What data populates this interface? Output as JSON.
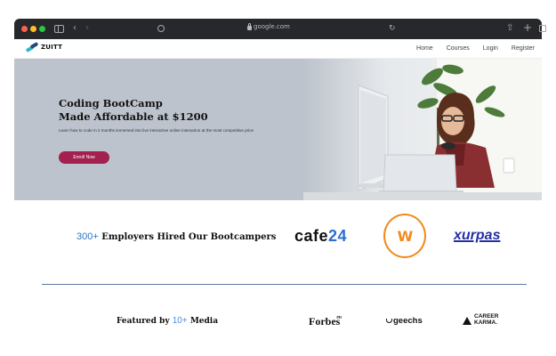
{
  "browser": {
    "url": "google.com",
    "icons": [
      "close-dot",
      "minimize-dot",
      "zoom-dot",
      "sidebar-icon",
      "back-icon",
      "forward-icon",
      "shield-icon",
      "lock-icon",
      "reload-icon",
      "share-icon",
      "new-tab-icon",
      "tab-overview-icon"
    ],
    "back_glyph": "‹",
    "forward_glyph": "›",
    "reload_glyph": "↻",
    "share_glyph": "⇧",
    "newtab_glyph": "+"
  },
  "nav": {
    "logo_text": "ZUITT",
    "links": [
      "Home",
      "Courses",
      "Login",
      "Register"
    ]
  },
  "hero": {
    "title_line1": "Coding BootCamp",
    "title_line2": "Made Affordable at $1200",
    "subtitle": "Learn how to code in 2 months immersed into live interactive online interaction at the most competitive price",
    "cta": "Enroll Now"
  },
  "employers": {
    "count": "300+",
    "text": "Employers Hired Our Bootcampers",
    "logo1": "cafe",
    "logo1_num": "24",
    "logo2": "W",
    "logo3": "xurpas"
  },
  "featured": {
    "prefix": "Featured by",
    "count": "10+",
    "suffix": "Media",
    "forbes": "Forbes",
    "forbes_sup": "PH",
    "geechs": "geechs",
    "career_line1": "CAREER",
    "career_line2": "KARMA."
  },
  "colors": {
    "accent_blue": "#2b76c8",
    "cta": "#a3214f",
    "w_logo": "#f28a1d",
    "xurpas": "#2530a6"
  }
}
